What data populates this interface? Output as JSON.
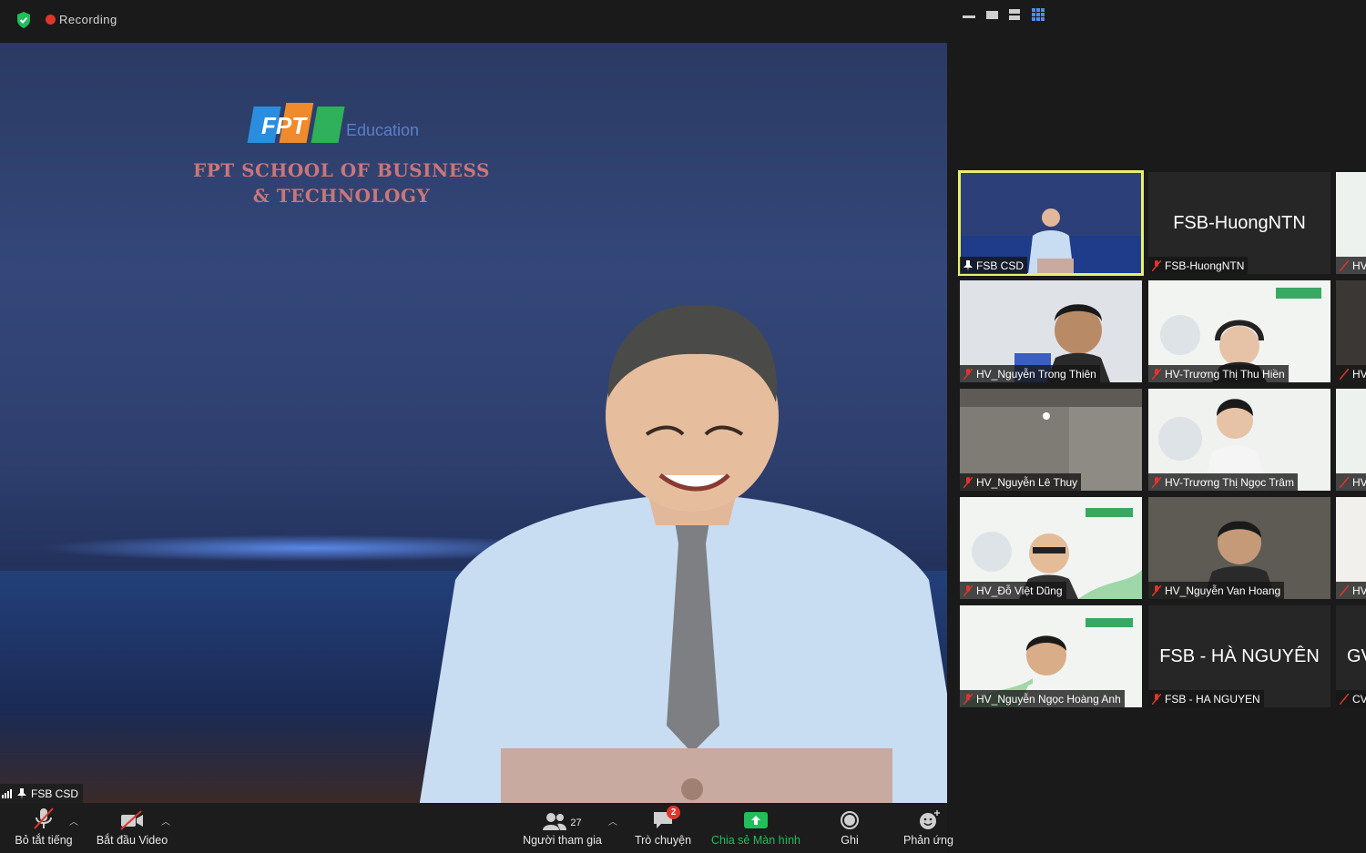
{
  "topbar": {
    "recording_label": "Recording"
  },
  "main_video": {
    "logo_text": "FPT",
    "logo_sub": "Education",
    "backdrop_line1": "FPT SCHOOL OF BUSINESS",
    "backdrop_line2": "& TECHNOLOGY",
    "name": "FSB CSD"
  },
  "gallery": [
    {
      "name": "FSB CSD",
      "active": true,
      "muted": false,
      "video": true
    },
    {
      "name": "FSB-HuongNTN",
      "big_label": "FSB-HuongNTN",
      "muted": true,
      "video": false
    },
    {
      "name": "HV_Nguyễn Trong Thiên",
      "muted": true,
      "video": true
    },
    {
      "name": "HV-Trương Thị Thu Hiền",
      "muted": true,
      "video": true
    },
    {
      "name": "HV_Nguyễn Lê Thuy",
      "muted": true,
      "video": true
    },
    {
      "name": "HV-Trương Thị Ngọc Trâm",
      "muted": true,
      "video": true
    },
    {
      "name": "HV_Đỗ Việt Dũng",
      "muted": true,
      "video": true
    },
    {
      "name": "HV_Nguyễn Van Hoang",
      "muted": true,
      "video": true
    },
    {
      "name": "HV_Nguyễn Ngọc Hoàng Anh",
      "muted": true,
      "video": true
    },
    {
      "name": "FSB - HA NGUYEN",
      "big_label": "FSB - HÀ NGUYÊN",
      "muted": true,
      "video": false
    }
  ],
  "gallery_partial": [
    "HV",
    "HV",
    "HV",
    "HV",
    "HV",
    "GV",
    "CV"
  ],
  "toolbar": {
    "mute_label": "Bỏ tắt tiếng",
    "video_label": "Bắt đầu Video",
    "participants_label": "Người tham gia",
    "participants_count": "27",
    "chat_label": "Trò chuyện",
    "chat_badge": "2",
    "share_label": "Chia sẻ Màn hình",
    "record_label": "Ghi",
    "reactions_label": "Phản ứng"
  },
  "colors": {
    "share_green": "#1fbf5a",
    "active_tile_border": "#e8f06b",
    "badge_red": "#e0352b",
    "mute_red": "#e0352b"
  }
}
